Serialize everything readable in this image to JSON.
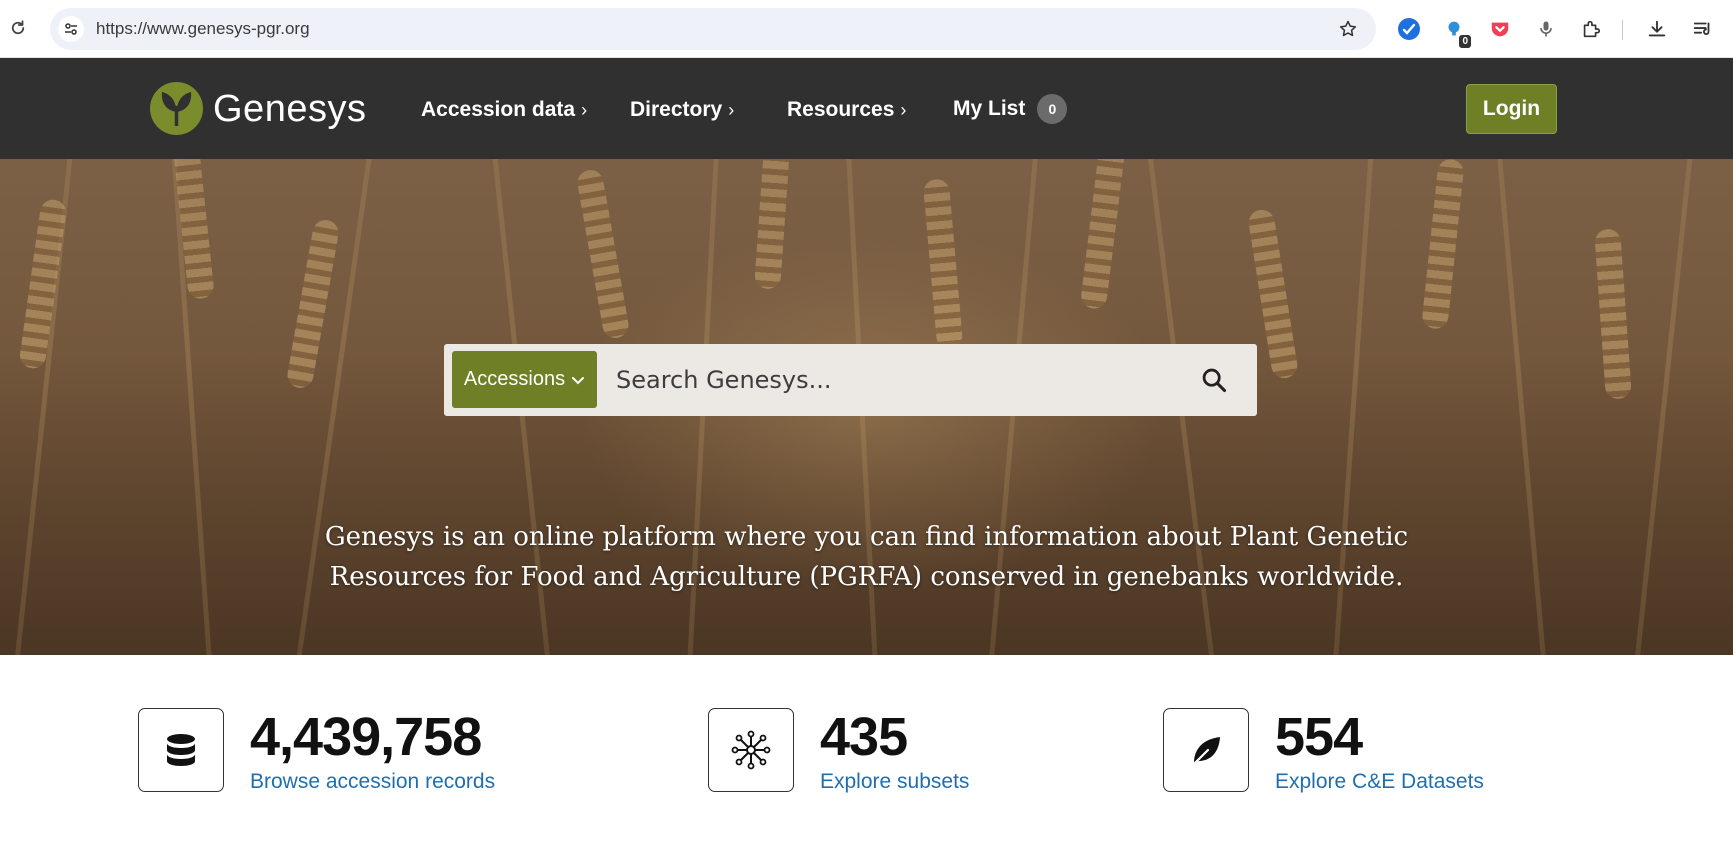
{
  "browser": {
    "url": "https://www.genesys-pgr.org",
    "extension_badge": "0"
  },
  "header": {
    "brand": "Genesys",
    "nav": [
      {
        "label": "Accession data",
        "chevron": "›"
      },
      {
        "label": "Directory",
        "chevron": "›"
      },
      {
        "label": "Resources",
        "chevron": "›"
      },
      {
        "label": "My List",
        "count": "0"
      }
    ],
    "login_label": "Login",
    "accent_color": "#6e7f26"
  },
  "search": {
    "type_label": "Accessions",
    "placeholder": "Search Genesys..."
  },
  "hero": {
    "text": "Genesys is an online platform where you can find information about Plant Genetic Resources for Food and Agriculture (PGRFA) conserved in genebanks worldwide."
  },
  "stats": [
    {
      "icon": "database-icon",
      "value": "4,439,758",
      "link": "Browse accession records"
    },
    {
      "icon": "network-icon",
      "value": "435",
      "link": "Explore subsets"
    },
    {
      "icon": "leaf-icon",
      "value": "554",
      "link": "Explore C&E Datasets"
    }
  ]
}
